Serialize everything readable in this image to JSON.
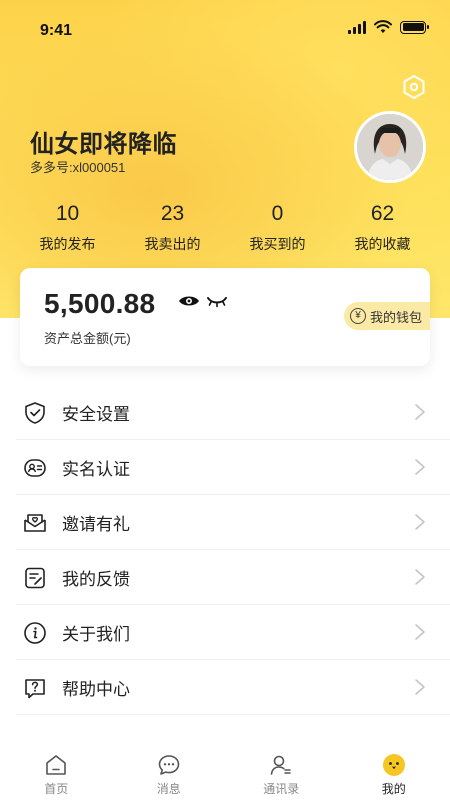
{
  "status_bar": {
    "time": "9:41"
  },
  "profile": {
    "name": "仙女即将降临",
    "id_label": "多多号:",
    "id_value": "xl000051"
  },
  "stats": [
    {
      "value": "10",
      "label": "我的发布"
    },
    {
      "value": "23",
      "label": "我卖出的"
    },
    {
      "value": "0",
      "label": "我买到的"
    },
    {
      "value": "62",
      "label": "我的收藏"
    }
  ],
  "wallet": {
    "amount": "5,500.88",
    "label": "资产总金额(元)",
    "button_label": "我的钱包",
    "button_icon": "¥"
  },
  "menu": [
    {
      "label": "安全设置",
      "icon": "shield-icon"
    },
    {
      "label": "实名认证",
      "icon": "id-card-icon"
    },
    {
      "label": "邀请有礼",
      "icon": "envelope-icon"
    },
    {
      "label": "我的反馈",
      "icon": "feedback-icon"
    },
    {
      "label": "关于我们",
      "icon": "info-icon"
    },
    {
      "label": "帮助中心",
      "icon": "help-icon"
    }
  ],
  "tabbar": [
    {
      "label": "首页",
      "icon": "home-icon",
      "active": false
    },
    {
      "label": "消息",
      "icon": "message-icon",
      "active": false
    },
    {
      "label": "通讯录",
      "icon": "contacts-icon",
      "active": false
    },
    {
      "label": "我的",
      "icon": "profile-icon",
      "active": true
    }
  ],
  "colors": {
    "accent": "#fdd54a",
    "wallet_button_bg": "#fbe9a6",
    "text": "#222222",
    "tab_inactive": "#888888"
  }
}
